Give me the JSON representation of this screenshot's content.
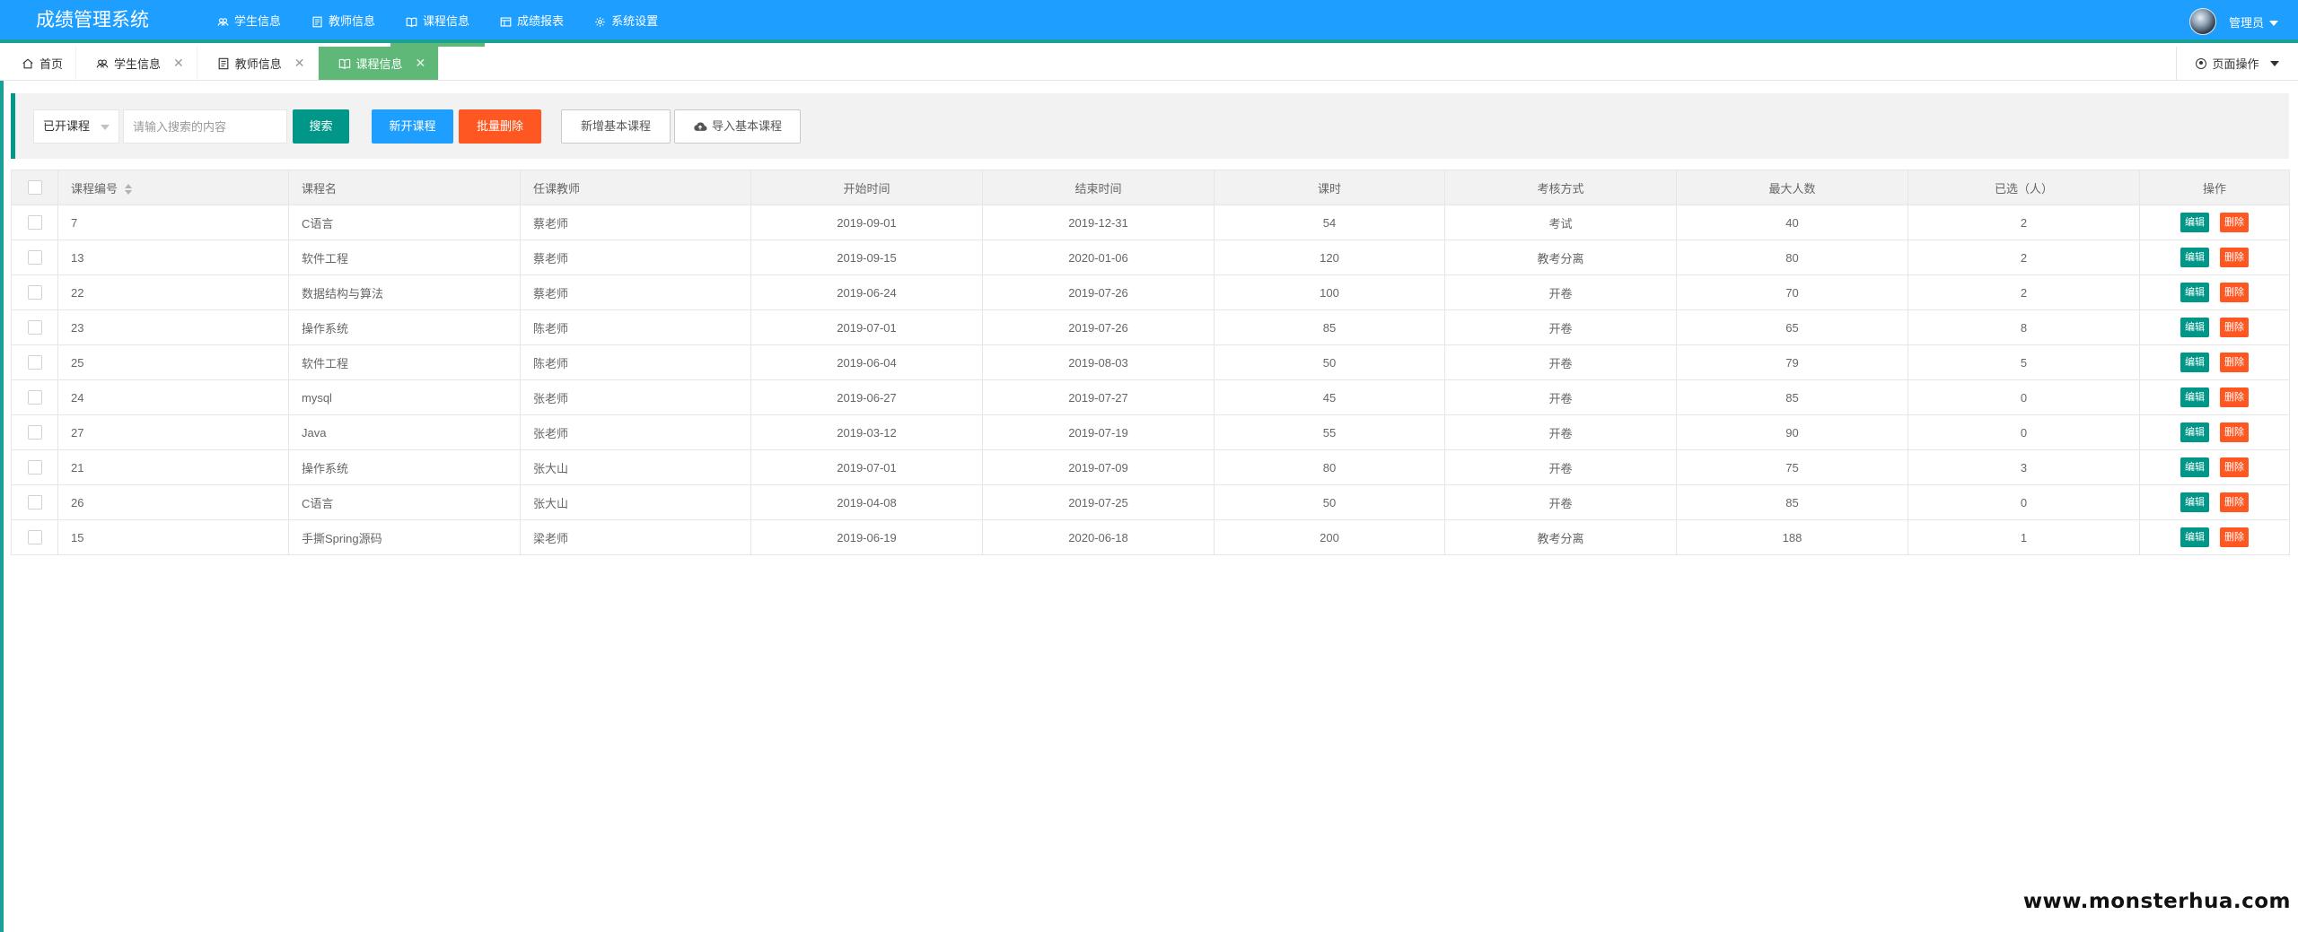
{
  "header": {
    "logo": "成绩管理系统",
    "nav": [
      {
        "label": "学生信息",
        "icon": "users-icon"
      },
      {
        "label": "教师信息",
        "icon": "id-card-icon"
      },
      {
        "label": "课程信息",
        "icon": "book-icon",
        "active": true
      },
      {
        "label": "成绩报表",
        "icon": "table-icon"
      },
      {
        "label": "系统设置",
        "icon": "gear-icon"
      }
    ],
    "user": "管理员"
  },
  "tabs": [
    {
      "label": "首页",
      "icon": "home-icon",
      "closable": false
    },
    {
      "label": "学生信息",
      "icon": "users-icon",
      "closable": true
    },
    {
      "label": "教师信息",
      "icon": "id-card-icon",
      "closable": true
    },
    {
      "label": "课程信息",
      "icon": "book-icon",
      "closable": true,
      "active": true
    }
  ],
  "tab_close_glyph": "✕",
  "page_ops_label": "页面操作",
  "toolbar": {
    "select_value": "已开课程",
    "search_placeholder": "请输入搜索的内容",
    "search_label": "搜索",
    "new_course_label": "新开课程",
    "bulk_delete_label": "批量删除",
    "add_basic_label": "新增基本课程",
    "import_basic_label": "导入基本课程"
  },
  "table": {
    "columns": [
      "课程编号",
      "课程名",
      "任课教师",
      "开始时间",
      "结束时间",
      "课时",
      "考核方式",
      "最大人数",
      "已选（人）",
      "操作"
    ],
    "edit_label": "编辑",
    "delete_label": "删除",
    "rows": [
      [
        "7",
        "C语言",
        "蔡老师",
        "2019-09-01",
        "2019-12-31",
        "54",
        "考试",
        "40",
        "2"
      ],
      [
        "13",
        "软件工程",
        "蔡老师",
        "2019-09-15",
        "2020-01-06",
        "120",
        "教考分离",
        "80",
        "2"
      ],
      [
        "22",
        "数据结构与算法",
        "蔡老师",
        "2019-06-24",
        "2019-07-26",
        "100",
        "开卷",
        "70",
        "2"
      ],
      [
        "23",
        "操作系统",
        "陈老师",
        "2019-07-01",
        "2019-07-26",
        "85",
        "开卷",
        "65",
        "8"
      ],
      [
        "25",
        "软件工程",
        "陈老师",
        "2019-06-04",
        "2019-08-03",
        "50",
        "开卷",
        "79",
        "5"
      ],
      [
        "24",
        "mysql",
        "张老师",
        "2019-06-27",
        "2019-07-27",
        "45",
        "开卷",
        "85",
        "0"
      ],
      [
        "27",
        "Java",
        "张老师",
        "2019-03-12",
        "2019-07-19",
        "55",
        "开卷",
        "90",
        "0"
      ],
      [
        "21",
        "操作系统",
        "张大山",
        "2019-07-01",
        "2019-07-09",
        "80",
        "开卷",
        "75",
        "3"
      ],
      [
        "26",
        "C语言",
        "张大山",
        "2019-04-08",
        "2019-07-25",
        "50",
        "开卷",
        "85",
        "0"
      ],
      [
        "15",
        "手撕Spring源码",
        "梁老师",
        "2019-06-19",
        "2020-06-18",
        "200",
        "教考分离",
        "188",
        "1"
      ]
    ]
  },
  "watermark": "www.monsterhua.com",
  "colors": {
    "header_bg": "#1E9FFF",
    "accent_green": "#009688",
    "tab_active": "#5FB878",
    "danger": "#FF5722",
    "primary_blue": "#1E9FFF"
  }
}
